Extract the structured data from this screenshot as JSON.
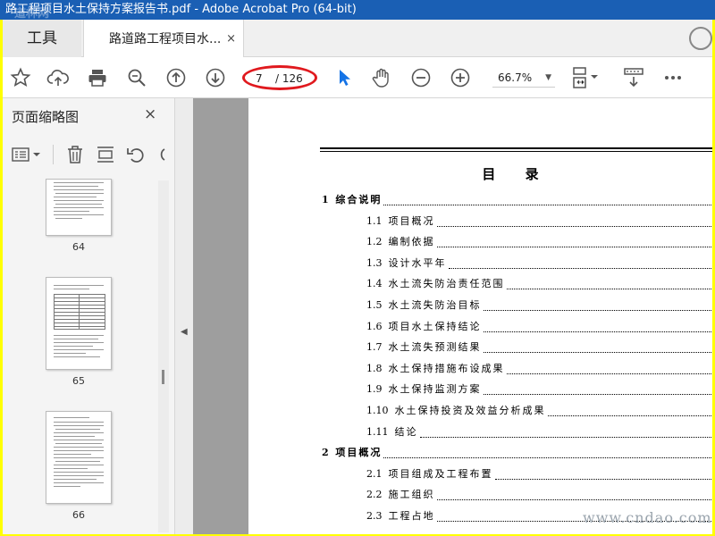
{
  "window": {
    "title": "路工程项目水土保持方案报告书.pdf - Adobe Acrobat Pro (64-bit)",
    "watermark_top": "道林网"
  },
  "tabs": {
    "tools_label": "工具",
    "doc_label": "路道路工程项目水...",
    "close_glyph": "×"
  },
  "toolbar": {
    "page_current": "7",
    "page_total": "/ 126",
    "zoom": "66.7%",
    "icons": [
      "star-icon",
      "cloud-upload-icon",
      "print-icon",
      "zoom-search-icon",
      "page-up-icon",
      "page-down-icon",
      "select-arrow-icon",
      "hand-icon",
      "zoom-out-icon",
      "zoom-in-icon",
      "fit-page-icon",
      "scroll-mode-icon",
      "more-icon"
    ],
    "highlight_color": "#e0191e"
  },
  "sidebar": {
    "title": "页面缩略图",
    "close_glyph": "×",
    "thumbnails": [
      {
        "page": "64"
      },
      {
        "page": "65"
      },
      {
        "page": "66"
      }
    ]
  },
  "document": {
    "toc_title": "目 录",
    "entries": [
      {
        "num": "1",
        "text": "综合说明",
        "level": 1
      },
      {
        "num": "1.1",
        "text": "项目概况",
        "level": 2
      },
      {
        "num": "1.2",
        "text": "编制依据",
        "level": 2
      },
      {
        "num": "1.3",
        "text": "设计水平年",
        "level": 2
      },
      {
        "num": "1.4",
        "text": "水土流失防治责任范围",
        "level": 2
      },
      {
        "num": "1.5",
        "text": "水土流失防治目标",
        "level": 2
      },
      {
        "num": "1.6",
        "text": "项目水土保持结论",
        "level": 2
      },
      {
        "num": "1.7",
        "text": "水土流失预测结果",
        "level": 2
      },
      {
        "num": "1.8",
        "text": "水土保持措施布设成果",
        "level": 2
      },
      {
        "num": "1.9",
        "text": "水土保持监测方案",
        "level": 2
      },
      {
        "num": "1.10",
        "text": "水土保持投资及效益分析成果",
        "level": 2
      },
      {
        "num": "1.11",
        "text": "结论",
        "level": 2
      },
      {
        "num": "2",
        "text": "项目概况",
        "level": 1
      },
      {
        "num": "2.1",
        "text": "项目组成及工程布置",
        "level": 2
      },
      {
        "num": "2.2",
        "text": "施工组织",
        "level": 2
      },
      {
        "num": "2.3",
        "text": "工程占地",
        "level": 2
      }
    ]
  },
  "watermark": {
    "site": "www.cndao.com"
  }
}
